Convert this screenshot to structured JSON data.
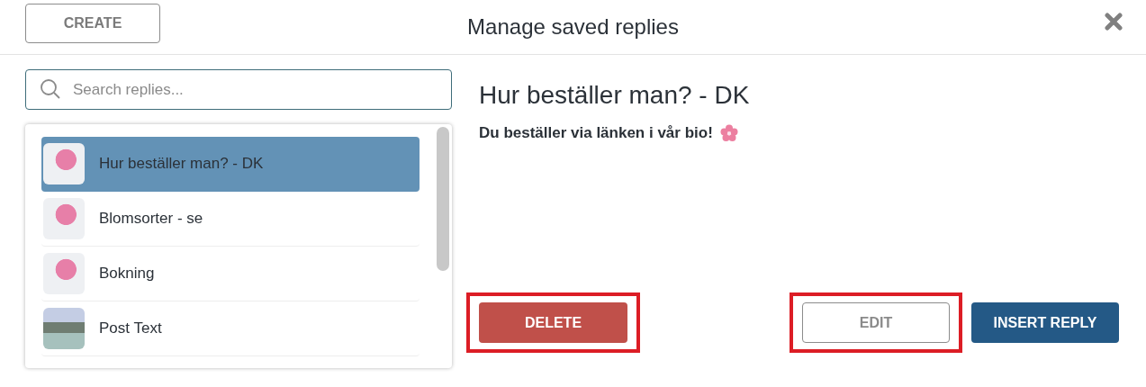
{
  "header": {
    "create_button": "CREATE",
    "title": "Manage saved replies"
  },
  "search": {
    "placeholder": "Search replies..."
  },
  "replies": [
    {
      "title": "Hur beställer man? - DK",
      "selected": true,
      "kind": "flower"
    },
    {
      "title": "Blomsorter - se",
      "selected": false,
      "kind": "flower"
    },
    {
      "title": "Bokning",
      "selected": false,
      "kind": "flower"
    },
    {
      "title": "Post Text",
      "selected": false,
      "kind": "landscape"
    }
  ],
  "detail": {
    "title": "Hur beställer man? - DK",
    "message": "Du beställer via länken i vår bio!"
  },
  "actions": [
    {
      "label": "DELETE",
      "kind": "danger",
      "highlighted": true
    },
    {
      "label": "EDIT",
      "kind": "outline",
      "highlighted": true
    },
    {
      "label": "INSERT REPLY",
      "kind": "primary",
      "highlighted": false
    }
  ]
}
